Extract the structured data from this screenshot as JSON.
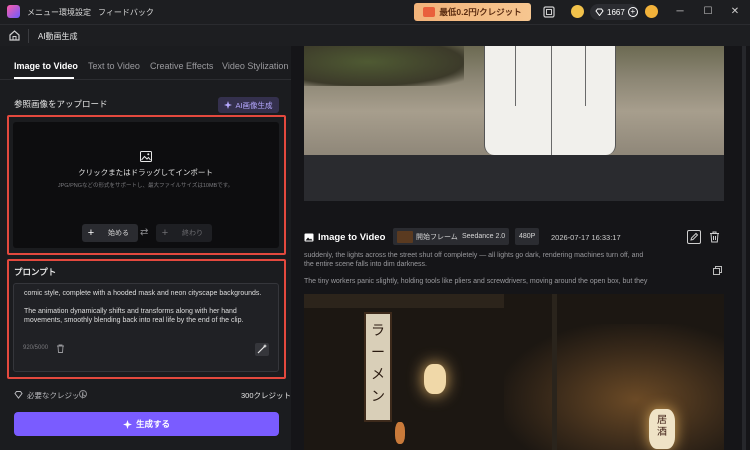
{
  "titlebar": {
    "menu": [
      "メニュー",
      "環境設定",
      "フィードバック"
    ],
    "promo": "最低0.2円/クレジット",
    "credits": "1667",
    "window_controls": [
      "minimize-icon",
      "maximize-icon",
      "close-icon"
    ]
  },
  "breadcrumb": {
    "title": "AI動画生成"
  },
  "tabs": [
    "Image to Video",
    "Text to Video",
    "Creative Effects",
    "Video Stylization"
  ],
  "upload": {
    "title": "参照画像をアップロード",
    "ai_button": "AI画像生成",
    "main_text": "クリックまたはドラッグしてインポート",
    "hint": "JPG/PNGなどの形式をサポートし、最大ファイルサイズは10MBです。",
    "start_label": "始める",
    "end_label": "終わり"
  },
  "prompt": {
    "title": "プロンプト",
    "text": "comic style, complete with a hooded mask and neon cityscape backgrounds.\n\nThe animation dynamically shifts and transforms along with her hand movements, smoothly blending back into real life by the end of the clip.",
    "count": "920/5000"
  },
  "credit": {
    "label": "必要なクレジット",
    "value": "300クレジット"
  },
  "generate_label": "生成する",
  "result": {
    "title": "Image to Video",
    "frame_tag": "開始フレーム",
    "model_tag": "Seedance 2.0",
    "resolution_tag": "480P",
    "timestamp": "2026-07-17 16:33:17",
    "desc_line1": "suddenly, the lights across the street shut off completely — all lights go dark, rendering machines turn off, and",
    "desc_line2": "the entire scene falls into dim darkness.",
    "desc_line3": "The tiny workers panic slightly, holding tools like pliers and screwdrivers, moving around the open box, but they"
  },
  "video_signs": {
    "sign1": "ラ\nー\nメ\nン",
    "sign2": "居\n酒"
  },
  "colors": {
    "accent": "#7a5cff",
    "highlight": "#e4493e",
    "promo": "#f2b37a"
  }
}
